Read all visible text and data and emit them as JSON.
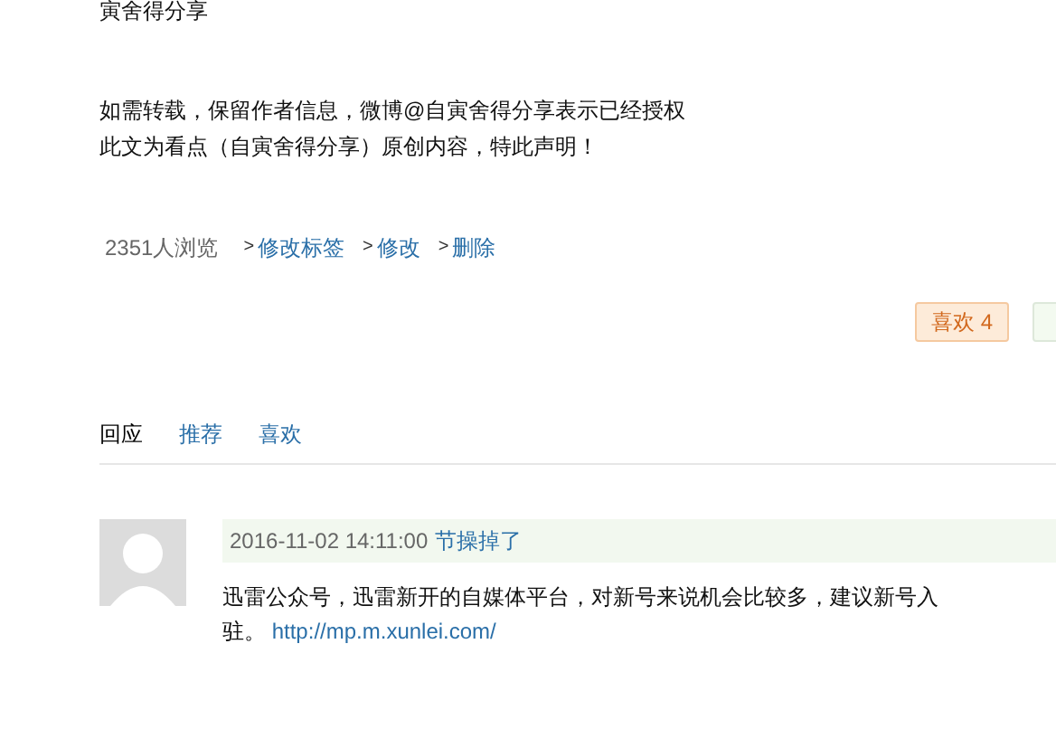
{
  "article_tail": {
    "author_line": "寅舍得分享",
    "notice_lines": [
      "如需转载，保留作者信息，微博@自寅舍得分享表示已经授权",
      "此文为看点（自寅舍得分享）原创内容，特此声明！"
    ]
  },
  "stats": {
    "views": "2351人浏览",
    "actions": [
      {
        "marker": ">",
        "label": "修改标签"
      },
      {
        "marker": ">",
        "label": "修改"
      },
      {
        "marker": ">",
        "label": "删除"
      }
    ]
  },
  "like_button": {
    "label": "喜欢 4"
  },
  "tabs": [
    {
      "label": "回应",
      "selected": true
    },
    {
      "label": "推荐",
      "selected": false
    },
    {
      "label": "喜欢",
      "selected": false
    }
  ],
  "comments": [
    {
      "time": "2016-11-02 14:11:00",
      "author": "节操掉了",
      "text": "迅雷公众号，迅雷新开的自媒体平台，对新号来说机会比较多，建议新号入驻。",
      "link": "http://mp.m.xunlei.com/"
    }
  ]
}
